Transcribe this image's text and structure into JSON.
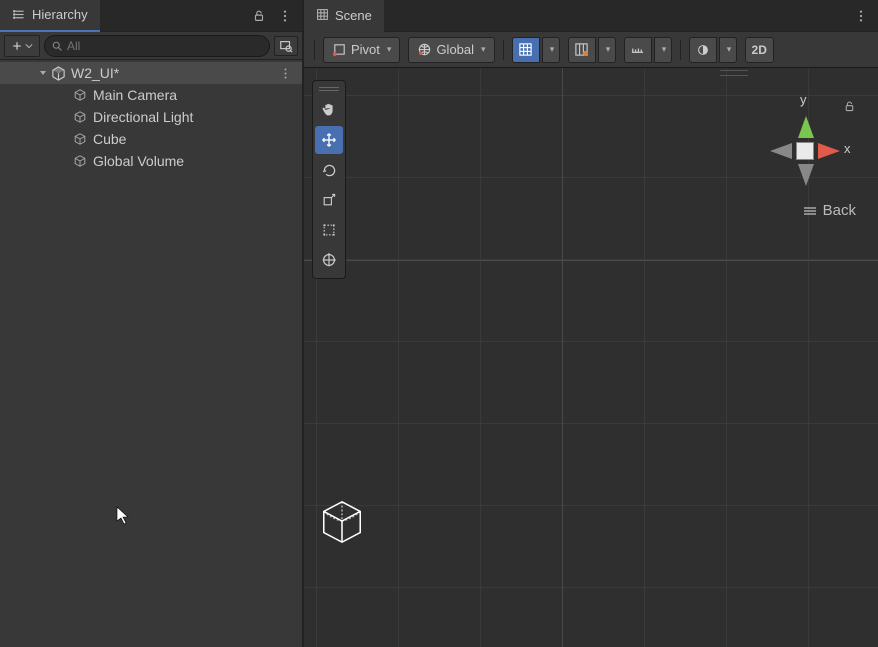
{
  "hierarchy": {
    "tab_label": "Hierarchy",
    "search_placeholder": "All",
    "scene_name": "W2_UI*",
    "items": [
      {
        "label": "Main Camera"
      },
      {
        "label": "Directional Light"
      },
      {
        "label": "Cube"
      },
      {
        "label": "Global Volume"
      }
    ]
  },
  "scene": {
    "tab_label": "Scene",
    "pivot_label": "Pivot",
    "global_label": "Global",
    "mode_2d": "2D",
    "axis_y": "y",
    "axis_x": "x",
    "back_label": "Back"
  }
}
